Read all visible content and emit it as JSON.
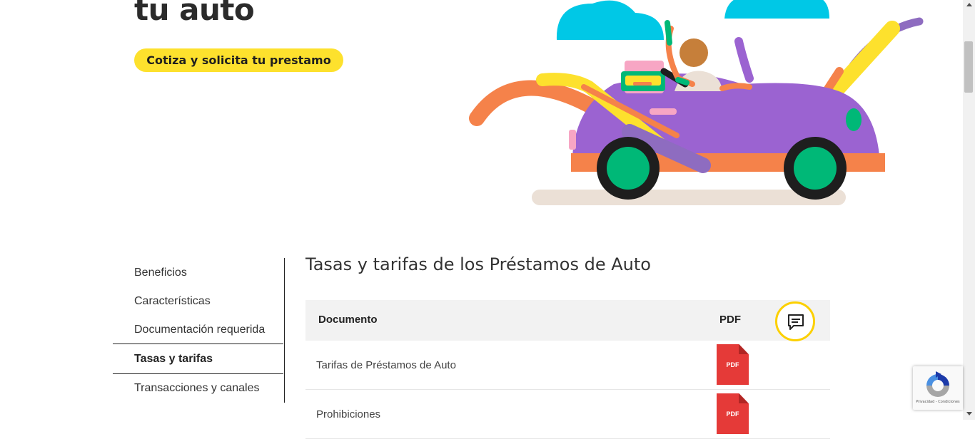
{
  "hero": {
    "title": "tu auto",
    "cta_label": "Cotiza y solicita tu prestamo"
  },
  "sidebar": {
    "items": [
      {
        "label": "Beneficios"
      },
      {
        "label": "Características"
      },
      {
        "label": "Documentación requerida"
      },
      {
        "label": "Tasas y tarifas"
      },
      {
        "label": "Transacciones y canales"
      }
    ],
    "active_item": "Tasas y tarifas"
  },
  "main": {
    "section_title": "Tasas y tarifas de los Préstamos de Auto",
    "table": {
      "headers": {
        "document": "Documento",
        "pdf": "PDF"
      },
      "rows": [
        {
          "document": "Tarifas de Préstamos de Auto",
          "pdf_label": "PDF"
        },
        {
          "document": "Prohibiciones",
          "pdf_label": "PDF"
        }
      ]
    }
  },
  "recaptcha": {
    "privacy": "Privacidad",
    "separator": "-",
    "terms": "Condiciones"
  },
  "icons": {
    "chat": "chat-bubble-icon",
    "pdf": "pdf-file-icon",
    "recaptcha": "recaptcha-icon",
    "illustration": "car-travel-illustration"
  },
  "colors": {
    "accent_yellow": "#fde12d",
    "chat_ring": "#fcd000",
    "pdf_red": "#e53a38",
    "car_purple": "#9b63d1",
    "sky_cyan": "#00c8e6"
  }
}
